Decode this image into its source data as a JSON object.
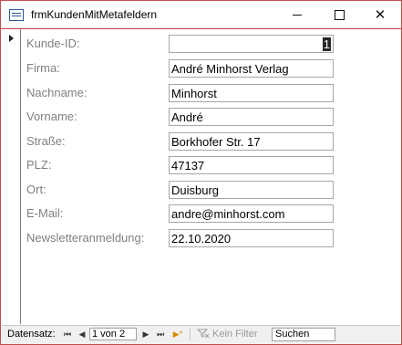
{
  "window": {
    "title": "frmKundenMitMetafeldern",
    "minimize_icon": "minimize-icon",
    "maximize_icon": "maximize-icon",
    "close_icon": "close-icon",
    "close_symbol": "✕"
  },
  "form": {
    "fields": [
      {
        "label": "Kunde-ID:",
        "value": "1"
      },
      {
        "label": "Firma:",
        "value": "André Minhorst Verlag"
      },
      {
        "label": "Nachname:",
        "value": "Minhorst"
      },
      {
        "label": "Vorname:",
        "value": "André"
      },
      {
        "label": "Straße:",
        "value": "Borkhofer Str. 17"
      },
      {
        "label": "PLZ:",
        "value": "47137"
      },
      {
        "label": "Ort:",
        "value": "Duisburg"
      },
      {
        "label": "E-Mail:",
        "value": "andre@minhorst.com"
      },
      {
        "label": "Newsletteranmeldung:",
        "value": "22.10.2020"
      }
    ]
  },
  "navigation": {
    "label": "Datensatz:",
    "record_position": "1 von 2",
    "filter_label": "Kein Filter",
    "search_value": "Suchen",
    "first_symbol": "⏮",
    "prev_symbol": "◀",
    "next_symbol": "▶",
    "last_symbol": "⏭",
    "new_symbol": "▶*"
  },
  "colors": {
    "window_border": "#c0504d",
    "label": "#808080",
    "field_border": "#a6a6a6",
    "selected_id_background": "#262626"
  }
}
